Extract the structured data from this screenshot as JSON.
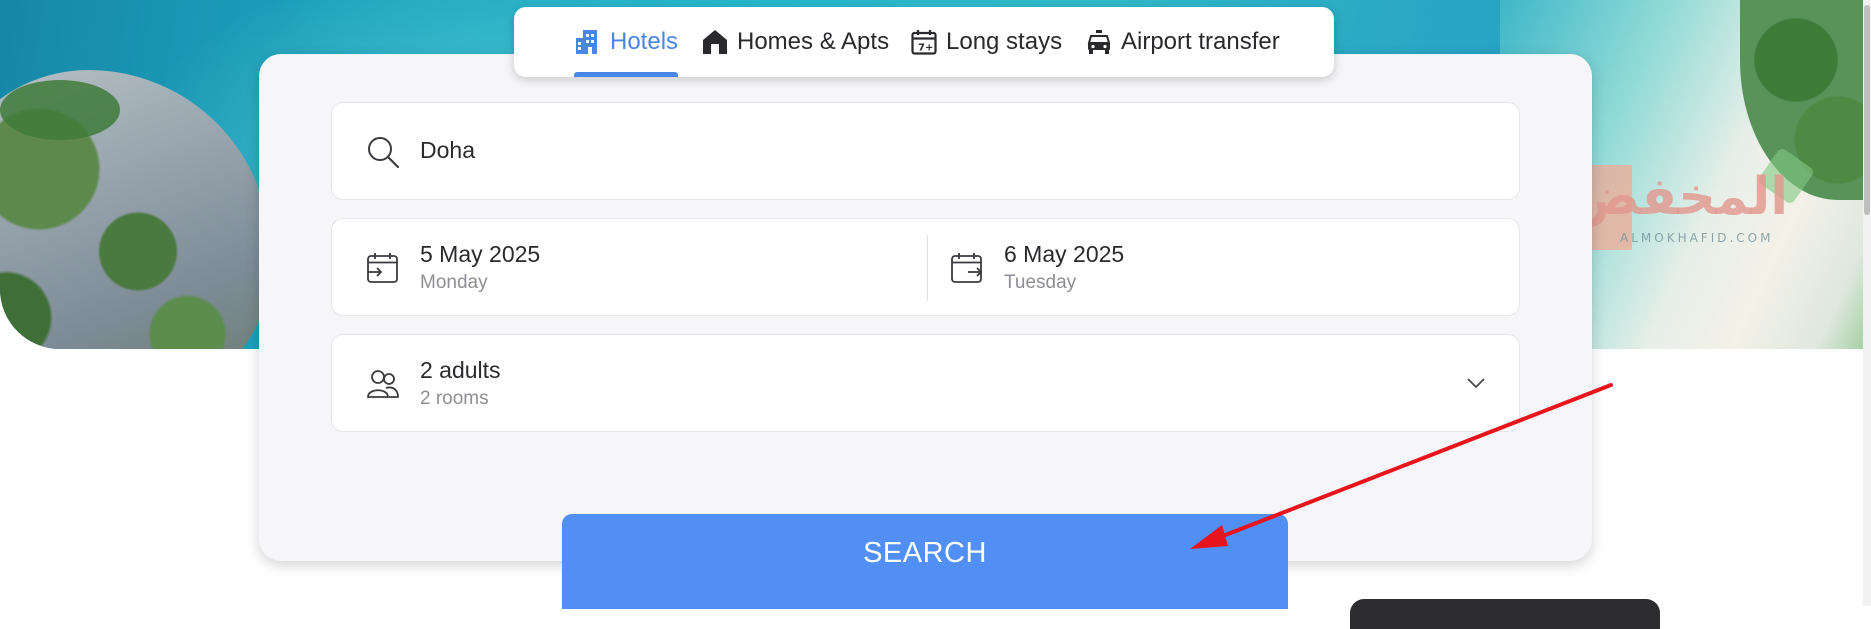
{
  "tabs": [
    {
      "label": "Hotels",
      "icon": "hotel-building-icon",
      "active": true
    },
    {
      "label": "Homes & Apts",
      "icon": "house-icon",
      "active": false
    },
    {
      "label": "Long stays",
      "icon": "calendar-7-icon",
      "active": false
    },
    {
      "label": "Airport transfer",
      "icon": "car-transfer-icon",
      "active": false
    }
  ],
  "search": {
    "destination_value": "Doha",
    "icon": "search-icon"
  },
  "dates": {
    "check_in": {
      "date": "5 May 2025",
      "weekday": "Monday",
      "icon": "calendar-check-in-icon"
    },
    "check_out": {
      "date": "6 May 2025",
      "weekday": "Tuesday",
      "icon": "calendar-check-out-icon"
    }
  },
  "occupancy": {
    "guests": "2 adults",
    "rooms": "2 rooms",
    "icon": "people-icon",
    "dropdown_icon": "chevron-down-icon"
  },
  "search_button": {
    "label": "SEARCH"
  },
  "watermark": {
    "arabic": "المخفض",
    "latin": "ALMOKHAFID.COM"
  },
  "colors": {
    "accent": "#4a86e8",
    "button": "#518ff5",
    "annotation_arrow": "#e8141c"
  }
}
